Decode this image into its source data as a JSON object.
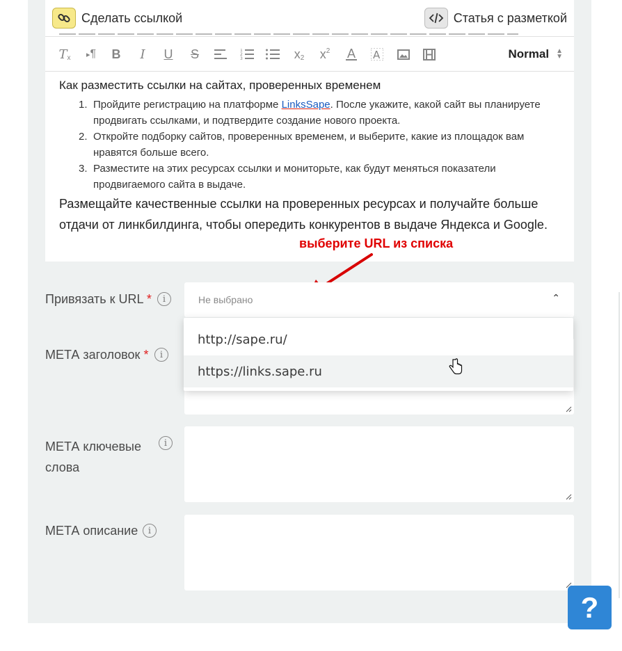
{
  "top_toolbar": {
    "make_link_label": "Сделать ссылкой",
    "markup_article_label": "Статья с разметкой"
  },
  "editor_toolbar": {
    "format_select_value": "Normal",
    "buttons": [
      "clear-format-icon",
      "paragraph-direction-icon",
      "bold-icon",
      "italic-icon",
      "underline-icon",
      "strikethrough-icon",
      "align-icon",
      "ordered-list-icon",
      "bullet-list-icon",
      "subscript-icon",
      "superscript-icon",
      "text-color-icon",
      "background-color-icon",
      "image-icon",
      "video-icon"
    ]
  },
  "content": {
    "heading": "Как разместить ссылки на сайтах, проверенных временем",
    "steps": [
      {
        "num": "1.",
        "before": "Пройдите регистрацию на платформе ",
        "link": "LinksSape",
        "after": ". После укажите, какой сайт вы планируете продвигать ссылками, и подтвердите создание нового проекта."
      },
      {
        "num": "2.",
        "text": "Откройте подборку сайтов, проверенных временем, и выберите, какие из площадок вам нравятся больше всего."
      },
      {
        "num": "3.",
        "text": "Разместите на этих ресурсах ссылки и мониторьте, как будут меняться показатели продвигаемого сайта в выдаче."
      }
    ],
    "paragraph": "Размещайте качественные ссылки на проверенных ресурсах и получайте больше отдачи от линкбилдинга, чтобы опередить конкурентов в выдаче Яндекса и Google."
  },
  "annotation": {
    "text": "выберите URL из списка",
    "color": "#e00000"
  },
  "form": {
    "url_label": "Привязать к URL",
    "required_mark": "*",
    "url_select_value": "Не выбрано",
    "url_options": [
      "http://sape.ru/",
      "https://links.sape.ru"
    ],
    "hovered_option_index": 1,
    "meta_title_label": "МЕТА заголовок",
    "meta_keywords_label_line1": "МЕТА ключевые",
    "meta_keywords_label_line2": "слова",
    "meta_description_label": "МЕТА описание",
    "info_glyph": "i"
  },
  "help_button": {
    "label": "?",
    "color": "#2f86d6"
  }
}
